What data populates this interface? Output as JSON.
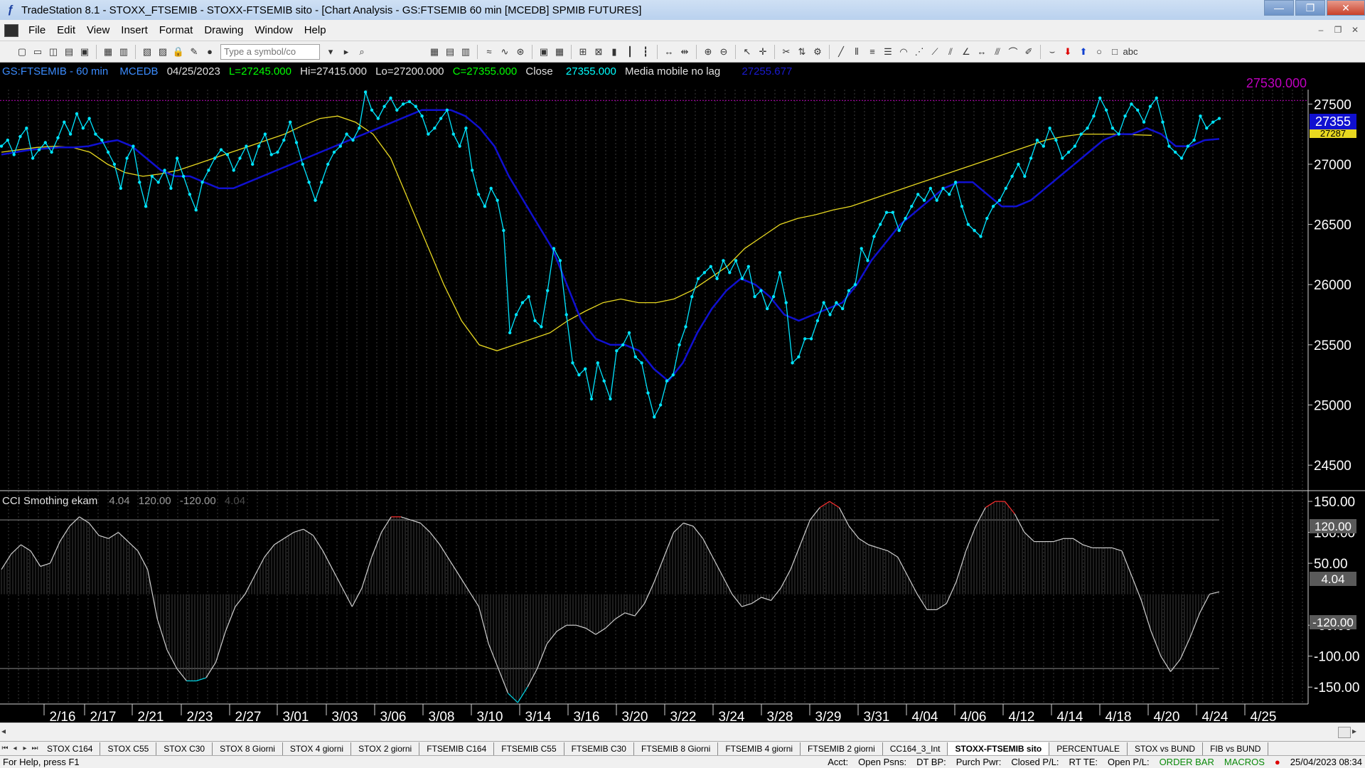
{
  "window": {
    "title": "TradeStation 8.1 - STOXX_FTSEMIB - STOXX-FTSEMIB sito - [Chart Analysis - GS:FTSEMIB  60 min  [MCEDB] SPMIB FUTURES]",
    "app_icon": "tradestation-logo-icon"
  },
  "menu": [
    "File",
    "Edit",
    "View",
    "Insert",
    "Format",
    "Drawing",
    "Window",
    "Help"
  ],
  "toolbar": {
    "symbol_placeholder": "Type a symbol/co"
  },
  "chart_header": {
    "symbol": "GS:FTSEMIB - 60 min",
    "feed": "MCEDB",
    "date": "04/25/2023",
    "last": "L=27245.000",
    "high": "Hi=27415.000",
    "low": "Lo=27200.000",
    "close": "C=27355.000",
    "close_label": "Close",
    "close_value": "27355.000",
    "study_name": "Media mobile no lag",
    "study_value": "27255.677"
  },
  "price_axis": {
    "ticks": [
      "27500",
      "27000",
      "26500",
      "26000",
      "25500",
      "25000",
      "24500"
    ],
    "marker_value": "27530.000",
    "last_price_box": "27355",
    "ma_box": "27287"
  },
  "indicator": {
    "name": "CCI Smothing ekam",
    "v1": "4.04",
    "v2": "120.00",
    "v3": "-120.00",
    "v4": "4.04",
    "ticks": [
      "150.00",
      "100.00",
      "50.00",
      "-50.00",
      "-100.00",
      "-150.00"
    ],
    "box_upper": "120.00",
    "box_value": "4.04",
    "box_lower": "-120.00"
  },
  "date_axis": [
    "2/16",
    "2/17",
    "2/21",
    "2/23",
    "2/27",
    "3/01",
    "3/03",
    "3/06",
    "3/08",
    "3/10",
    "3/14",
    "3/16",
    "3/20",
    "3/22",
    "3/24",
    "3/28",
    "3/29",
    "3/31",
    "4/04",
    "4/06",
    "4/12",
    "4/14",
    "4/18",
    "4/20",
    "4/24",
    "4/25"
  ],
  "tabs": [
    "STOX C164",
    "STOX C55",
    "STOX C30",
    "STOX 8 Giorni",
    "STOX 4 giorni",
    "STOX 2 giorni",
    "FTSEMIB C164",
    "FTSEMIB C55",
    "FTSEMIB C30",
    "FTSEMIB 8 Giorni",
    "FTSEMIB 4 giorni",
    "FTSEMIB 2 giorni",
    "CC164_3_Int",
    "STOXX-FTSEMIB sito",
    "PERCENTUALE",
    "STOX vs BUND",
    "FIB vs BUND"
  ],
  "active_tab": "STOXX-FTSEMIB sito",
  "status": {
    "help": "For Help, press F1",
    "acct": "Acct:",
    "open_psns": "Open Psns:",
    "dt_bp": "DT BP:",
    "purch_pwr": "Purch Pwr:",
    "closed_pl": "Closed P/L:",
    "rt_te": "RT TE:",
    "open_pl": "Open P/L:",
    "order_bar": "ORDER BAR",
    "macros": "MACROS",
    "datetime": "25/04/2023 08:34"
  },
  "colors": {
    "price": "#00e5ff",
    "ma_fast": "#1010d0",
    "ma_slow": "#e8d820",
    "cci": "#cfcfcf",
    "cci_hi": "#ff3030",
    "cci_lo": "#00d8e8",
    "header_green": "#00ff00",
    "header_blue": "#3b8cff",
    "marker": "#c000c0"
  },
  "chart_data": [
    {
      "type": "line",
      "subtype": "price",
      "title": "GS:FTSEMIB - 60 min",
      "ylim": [
        24300,
        27620
      ],
      "y_ticks": [
        24500,
        25000,
        25500,
        26000,
        26500,
        27000,
        27500
      ],
      "x_tick_labels": [
        "2/16",
        "2/17",
        "2/21",
        "2/23",
        "2/27",
        "3/01",
        "3/03",
        "3/06",
        "3/08",
        "3/10",
        "3/14",
        "3/16",
        "3/20",
        "3/22",
        "3/24",
        "3/28",
        "3/29",
        "3/31",
        "4/04",
        "4/06",
        "4/12",
        "4/14",
        "4/18",
        "4/20",
        "4/24",
        "4/25"
      ],
      "grid": "vertical-dotted",
      "reference_line": 27530,
      "series": [
        {
          "key": "price",
          "values": [
            27150,
            27200,
            27080,
            27230,
            27300,
            27050,
            27120,
            27180,
            27100,
            27220,
            27350,
            27250,
            27420,
            27300,
            27380,
            27250,
            27200,
            27100,
            27000,
            26800,
            27050,
            27150,
            26850,
            26650,
            26900,
            26850,
            26950,
            26800,
            27050,
            26900,
            26750,
            26620,
            26850,
            26950,
            27050,
            27120,
            27080,
            26950,
            27050,
            27150,
            27000,
            27150,
            27250,
            27080,
            27100,
            27200,
            27350,
            27180,
            27000,
            26850,
            26700,
            26850,
            27000,
            27100,
            27150,
            27250,
            27200,
            27300,
            27600,
            27450,
            27380,
            27480,
            27550,
            27450,
            27500,
            27520,
            27480,
            27400,
            27250,
            27300,
            27380,
            27450,
            27250,
            27150,
            27300,
            26950,
            26750,
            26650,
            26800,
            26700,
            26450,
            25600,
            25750,
            25850,
            25900,
            25700,
            25650,
            25950,
            26300,
            26200,
            25750,
            25350,
            25250,
            25300,
            25050,
            25350,
            25200,
            25050,
            25450,
            25500,
            25600,
            25400,
            25350,
            25100,
            24900,
            25000,
            25200,
            25250,
            25500,
            25650,
            25900,
            26050,
            26100,
            26150,
            26050,
            26200,
            26100,
            26200,
            26050,
            26150,
            25900,
            25950,
            25800,
            25900,
            26100,
            25850,
            25350,
            25400,
            25550,
            25550,
            25700,
            25850,
            25750,
            25850,
            25800,
            25950,
            26000,
            26300,
            26200,
            26400,
            26500,
            26600,
            26600,
            26450,
            26550,
            26650,
            26750,
            26700,
            26800,
            26700,
            26800,
            26750,
            26850,
            26650,
            26500,
            26450,
            26400,
            26550,
            26650,
            26700,
            26800,
            26900,
            27000,
            26900,
            27050,
            27200,
            27150,
            27300,
            27200,
            27050,
            27100,
            27150,
            27250,
            27300,
            27400,
            27550,
            27450,
            27300,
            27250,
            27400,
            27500,
            27450,
            27350,
            27480,
            27550,
            27350,
            27150,
            27100,
            27050,
            27150,
            27200,
            27400,
            27300,
            27350,
            27380
          ]
        },
        {
          "key": "ma_fast",
          "values": [
            27080,
            27100,
            27120,
            27130,
            27140,
            27140,
            27150,
            27180,
            27200,
            27150,
            27050,
            26950,
            26900,
            26900,
            26850,
            26800,
            26800,
            26850,
            26900,
            26950,
            27000,
            27050,
            27100,
            27150,
            27200,
            27250,
            27300,
            27350,
            27400,
            27450,
            27450,
            27450,
            27400,
            27300,
            27150,
            26900,
            26700,
            26500,
            26300,
            26000,
            25700,
            25550,
            25500,
            25500,
            25450,
            25300,
            25200,
            25350,
            25600,
            25800,
            25950,
            26050,
            26000,
            25900,
            25750,
            25700,
            25750,
            25800,
            25850,
            26000,
            26200,
            26350,
            26500,
            26600,
            26700,
            26800,
            26850,
            26850,
            26750,
            26650,
            26650,
            26700,
            26800,
            26900,
            27000,
            27100,
            27200,
            27250,
            27250,
            27300,
            27250,
            27150,
            27150,
            27200,
            27210
          ]
        },
        {
          "key": "ma_slow",
          "values": [
            27100,
            27120,
            27140,
            27150,
            27140,
            27100,
            27000,
            26930,
            26900,
            26920,
            26950,
            27000,
            27050,
            27100,
            27150,
            27200,
            27250,
            27320,
            27380,
            27400,
            27350,
            27250,
            27050,
            26700,
            26350,
            26000,
            25700,
            25500,
            25450,
            25500,
            25550,
            25600,
            25700,
            25780,
            25850,
            25880,
            25850,
            25850,
            25880,
            25950,
            26050,
            26150,
            26300,
            26400,
            26500,
            26550,
            26580,
            26620,
            26650,
            26700,
            26750,
            26800,
            26850,
            26900,
            26950,
            27000,
            27050,
            27100,
            27150,
            27200,
            27230,
            27250,
            27250,
            27250,
            27245,
            27240
          ]
        }
      ]
    },
    {
      "type": "area",
      "subtype": "oscillator",
      "title": "CCI Smothing ekam",
      "ylim": [
        -175,
        165
      ],
      "y_ticks": [
        -150,
        -100,
        -50,
        50,
        100,
        150
      ],
      "levels": [
        120,
        -120
      ],
      "series": [
        {
          "key": "cci",
          "values": [
            40,
            65,
            80,
            70,
            45,
            50,
            85,
            110,
            125,
            115,
            95,
            90,
            100,
            85,
            70,
            40,
            -40,
            -90,
            -120,
            -140,
            -140,
            -135,
            -110,
            -60,
            -20,
            0,
            30,
            60,
            80,
            90,
            100,
            105,
            95,
            70,
            40,
            10,
            -20,
            10,
            60,
            100,
            125,
            125,
            120,
            115,
            100,
            80,
            55,
            30,
            5,
            -20,
            -80,
            -120,
            -160,
            -175,
            -150,
            -120,
            -80,
            -60,
            -50,
            -50,
            -55,
            -65,
            -55,
            -40,
            -30,
            -35,
            -15,
            20,
            60,
            100,
            115,
            110,
            90,
            60,
            30,
            0,
            -20,
            -15,
            -5,
            -10,
            10,
            40,
            80,
            120,
            140,
            150,
            140,
            110,
            90,
            80,
            75,
            70,
            60,
            30,
            0,
            -25,
            -25,
            -15,
            20,
            70,
            110,
            140,
            150,
            150,
            130,
            100,
            85,
            85,
            85,
            90,
            90,
            80,
            75,
            75,
            75,
            70,
            30,
            -10,
            -60,
            -100,
            -125,
            -105,
            -70,
            -30,
            0,
            4
          ]
        }
      ]
    }
  ]
}
